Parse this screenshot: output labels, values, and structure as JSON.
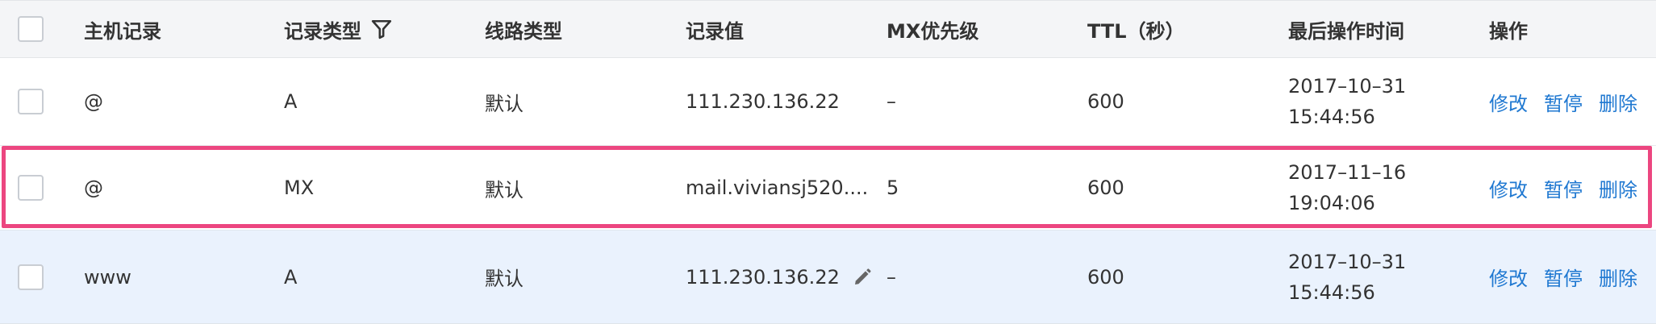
{
  "header": {
    "host": "主机记录",
    "type": "记录类型",
    "line": "线路类型",
    "value": "记录值",
    "mx": "MX优先级",
    "ttl": "TTL（秒）",
    "time": "最后操作时间",
    "ops": "操作"
  },
  "rows": [
    {
      "host": "@",
      "type": "A",
      "line": "默认",
      "value": "111.230.136.22",
      "mx": "–",
      "ttl": "600",
      "date": "2017–10–31",
      "time": "15:44:56",
      "op_edit": "修改",
      "op_pause": "暂停",
      "op_delete": "删除"
    },
    {
      "host": "@",
      "type": "MX",
      "line": "默认",
      "value": "mail.viviansj520....",
      "mx": "5",
      "ttl": "600",
      "date": "2017–11–16",
      "time": "19:04:06",
      "op_edit": "修改",
      "op_pause": "暂停",
      "op_delete": "删除"
    },
    {
      "host": "www",
      "type": "A",
      "line": "默认",
      "value": "111.230.136.22",
      "mx": "–",
      "ttl": "600",
      "date": "2017–10–31",
      "time": "15:44:56",
      "op_edit": "修改",
      "op_pause": "暂停",
      "op_delete": "删除"
    }
  ],
  "icons": {
    "filter": "filter-icon",
    "edit": "pencil-icon"
  },
  "colors": {
    "link": "#1f78d1",
    "highlight": "#ec4680",
    "hover_row": "#eaf2fd",
    "header_bg": "#f4f5f7"
  }
}
